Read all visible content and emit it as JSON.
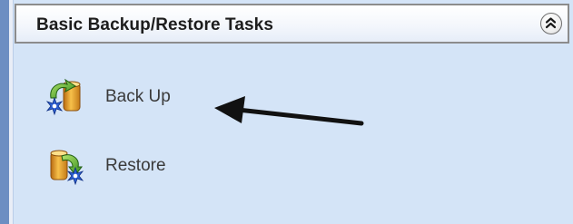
{
  "panel": {
    "title": "Basic Backup/Restore Tasks",
    "collapse_icon": "double-chevron-up-icon"
  },
  "tasks": [
    {
      "label": "Back Up",
      "icon": "backup-icon"
    },
    {
      "label": "Restore",
      "icon": "restore-icon"
    }
  ],
  "annotation": {
    "icon": "pointer-arrow-icon",
    "color": "#111111"
  },
  "colors": {
    "panel_background": "#d4e4f7",
    "left_rail": "#6c8ec2",
    "header_border": "#8c8c8c"
  }
}
